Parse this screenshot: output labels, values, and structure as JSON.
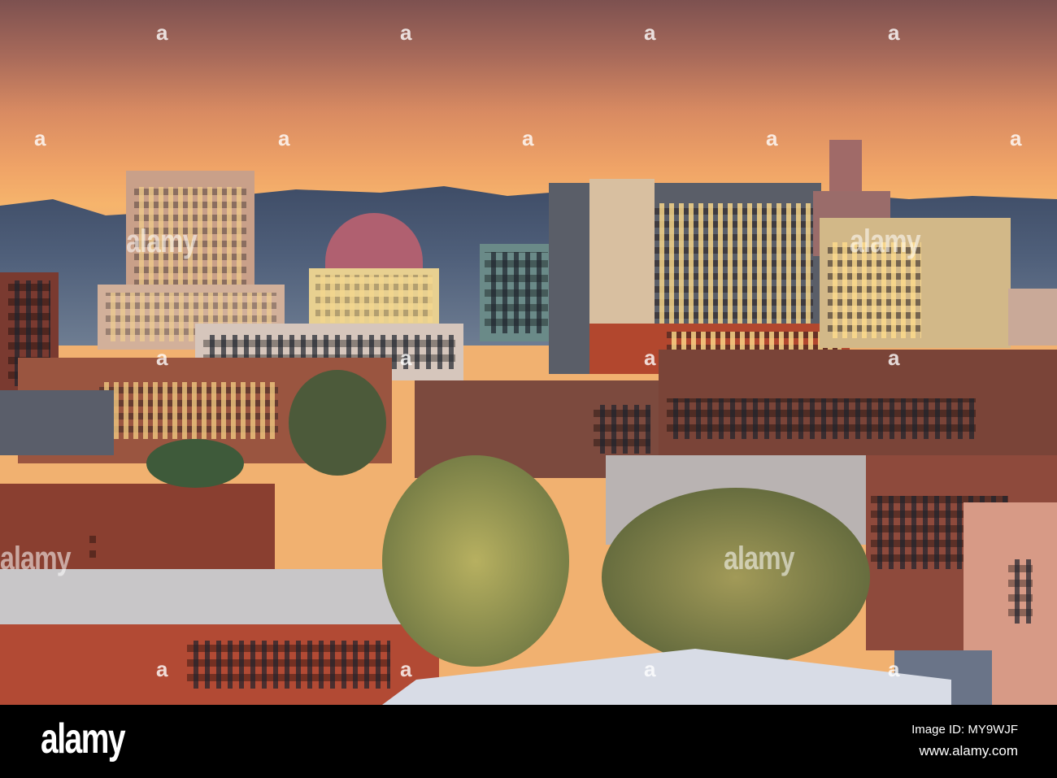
{
  "photo": {
    "subject": "City skyline at dusk",
    "colors": {
      "sky_top": "#7d5150",
      "sky_glow": "#f6b46c",
      "hills": "#4f5f7a",
      "brick": "#8a3f30"
    }
  },
  "watermark": {
    "glyph": "a",
    "word": "alamy"
  },
  "footer": {
    "logo": "alamy",
    "image_id": "Image ID: MY9WJF",
    "website": "www.alamy.com"
  }
}
